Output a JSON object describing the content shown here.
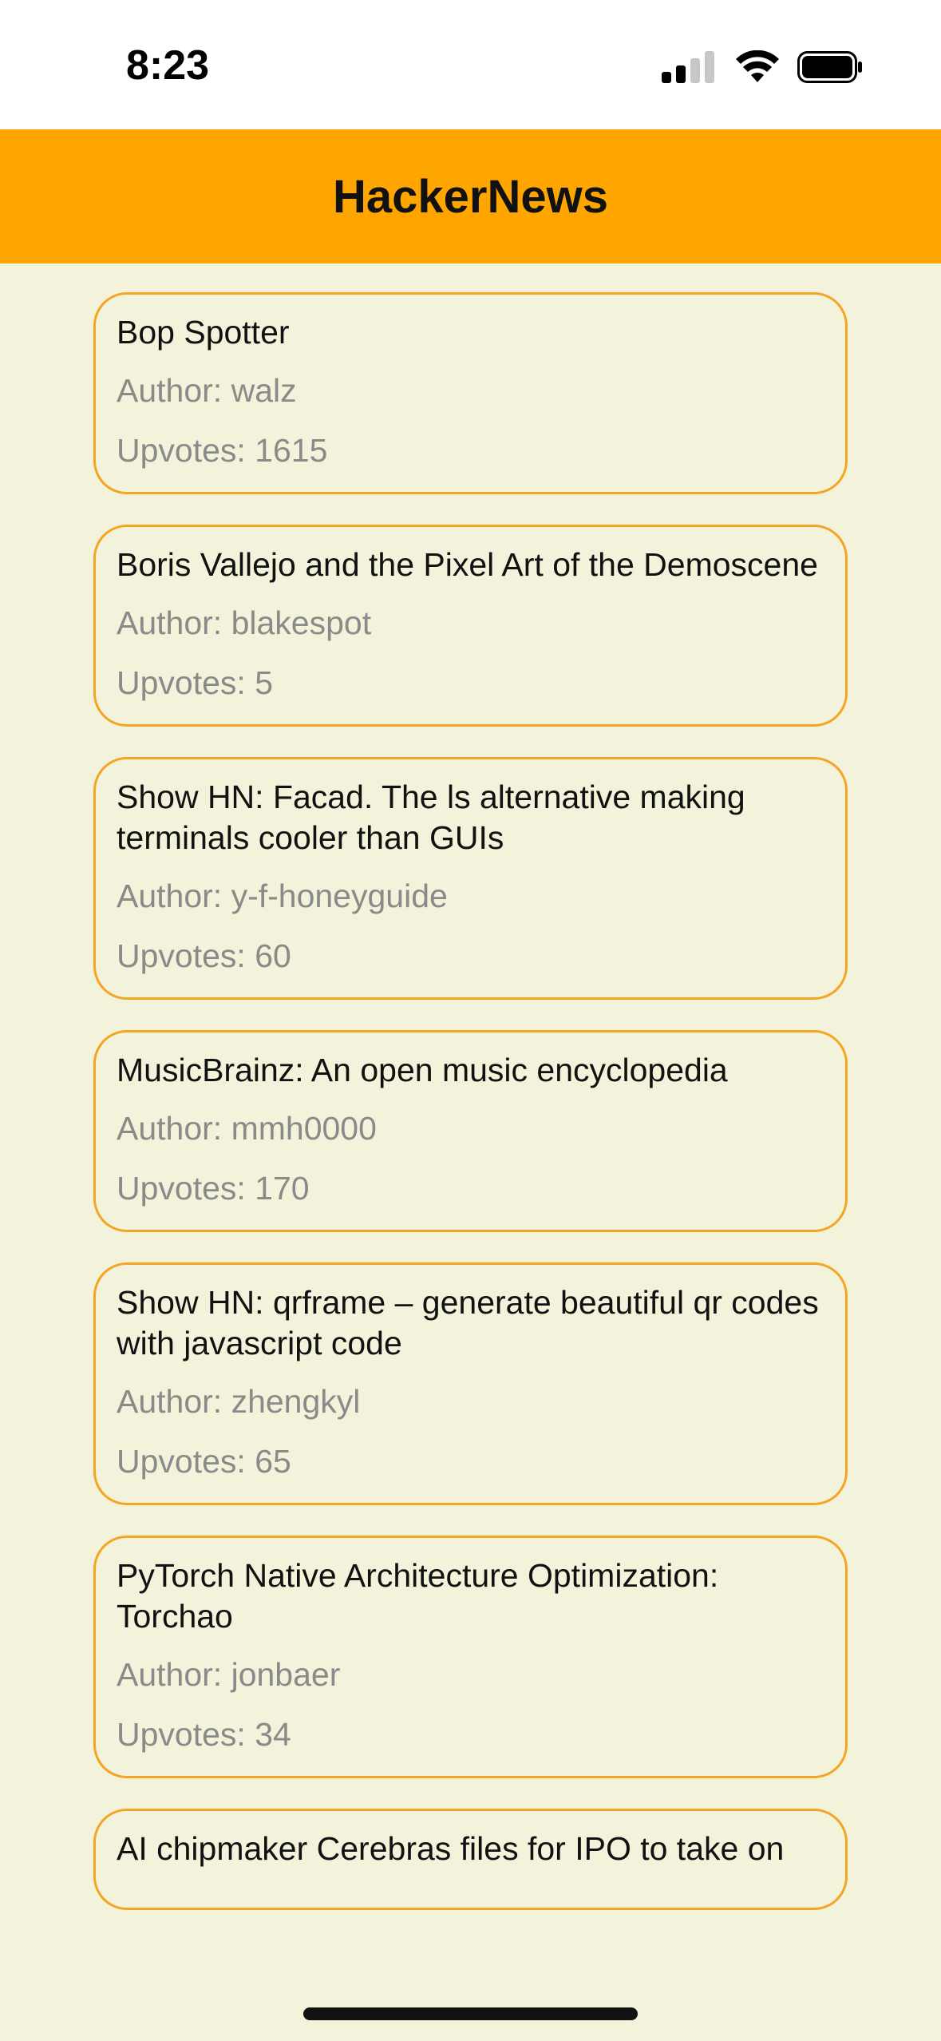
{
  "status_bar": {
    "time": "8:23",
    "icons": [
      "cellular-signal-icon",
      "wifi-icon",
      "battery-icon"
    ]
  },
  "header": {
    "title": "HackerNews",
    "background": "#ffa500"
  },
  "colors": {
    "background": "#f3f2da",
    "card_border": "#f5a524",
    "meta_text": "#8a8a8a"
  },
  "stories": [
    {
      "title": "Bop Spotter",
      "author": "Author: walz",
      "upvotes": "Upvotes: 1615"
    },
    {
      "title": "Boris Vallejo and the Pixel Art of the Demoscene",
      "author": "Author: blakespot",
      "upvotes": "Upvotes: 5"
    },
    {
      "title": "Show HN: Facad. The ls alternative making terminals cooler than GUIs",
      "author": "Author: y-f-honeyguide",
      "upvotes": "Upvotes: 60"
    },
    {
      "title": "MusicBrainz: An open music encyclopedia",
      "author": "Author: mmh0000",
      "upvotes": "Upvotes: 170"
    },
    {
      "title": "Show HN: qrframe – generate beautiful qr codes with javascript code",
      "author": "Author: zhengkyl",
      "upvotes": "Upvotes: 65"
    },
    {
      "title": "PyTorch Native Architecture Optimization: Torchao",
      "author": "Author: jonbaer",
      "upvotes": "Upvotes: 34"
    },
    {
      "title": "AI chipmaker Cerebras files for IPO to take on",
      "author": "",
      "upvotes": ""
    }
  ]
}
